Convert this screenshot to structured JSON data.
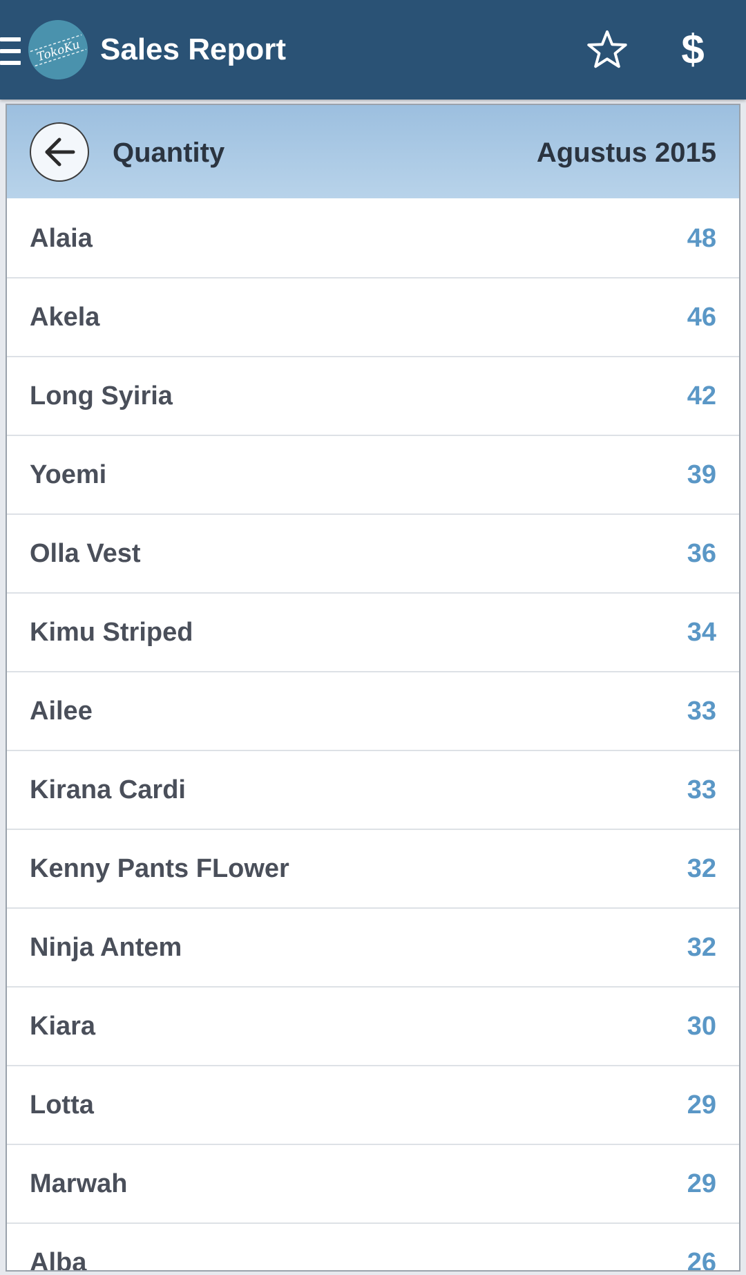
{
  "app_bar": {
    "title": "Sales Report",
    "logo_text": "TokoKu",
    "menu_icon": "hamburger-menu-icon",
    "favorite_icon": "star-outline-icon",
    "currency_symbol": "$",
    "background_color": "#2a5275"
  },
  "report": {
    "metric_label": "Quantity",
    "period": "Agustus 2015",
    "back_icon": "arrow-left-icon",
    "accent_color": "#5a97c6"
  },
  "items": [
    {
      "name": "Alaia",
      "qty": "48"
    },
    {
      "name": "Akela",
      "qty": "46"
    },
    {
      "name": "Long Syiria",
      "qty": "42"
    },
    {
      "name": "Yoemi",
      "qty": "39"
    },
    {
      "name": "Olla Vest",
      "qty": "36"
    },
    {
      "name": "Kimu Striped",
      "qty": "34"
    },
    {
      "name": "Ailee",
      "qty": "33"
    },
    {
      "name": "Kirana Cardi",
      "qty": "33"
    },
    {
      "name": "Kenny Pants FLower",
      "qty": "32"
    },
    {
      "name": "Ninja Antem",
      "qty": "32"
    },
    {
      "name": "Kiara",
      "qty": "30"
    },
    {
      "name": "Lotta",
      "qty": "29"
    },
    {
      "name": "Marwah",
      "qty": "29"
    },
    {
      "name": "Alba",
      "qty": "26"
    }
  ]
}
